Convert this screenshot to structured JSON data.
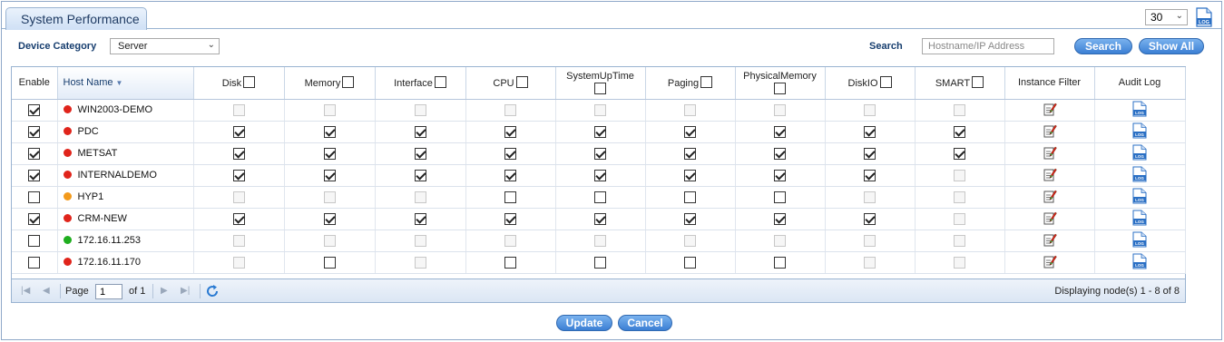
{
  "panel": {
    "tab_title": "System Performance",
    "per_page": "30"
  },
  "filters": {
    "device_category_label": "Device Category",
    "device_category_value": "Server",
    "search_label": "Search",
    "search_placeholder": "Hostname/IP Address",
    "search_button": "Search",
    "show_all_button": "Show All"
  },
  "columns": {
    "enable": "Enable",
    "host_name": "Host Name",
    "disk": "Disk",
    "memory": "Memory",
    "interface": "Interface",
    "cpu": "CPU",
    "systemuptime": "SystemUpTime",
    "paging": "Paging",
    "physicalmemory": "PhysicalMemory",
    "diskio": "DiskIO",
    "smart": "SMART",
    "instance_filter": "Instance Filter",
    "audit_log": "Audit Log"
  },
  "status_colors": {
    "red": "#e0241b",
    "orange": "#f39a1c",
    "green": "#1fae1f"
  },
  "rows": [
    {
      "enable": true,
      "status": "red",
      "host": "WIN2003-DEMO",
      "metrics": [
        "dis",
        "dis",
        "dis",
        "dis",
        "dis",
        "dis",
        "dis",
        "dis",
        "dis"
      ]
    },
    {
      "enable": true,
      "status": "red",
      "host": "PDC",
      "metrics": [
        "on",
        "on",
        "on",
        "on",
        "on",
        "on",
        "on",
        "on",
        "on"
      ]
    },
    {
      "enable": true,
      "status": "red",
      "host": "METSAT",
      "metrics": [
        "on",
        "on",
        "on",
        "on",
        "on",
        "on",
        "on",
        "on",
        "on"
      ]
    },
    {
      "enable": true,
      "status": "red",
      "host": "INTERNALDEMO",
      "metrics": [
        "on",
        "on",
        "on",
        "on",
        "on",
        "on",
        "on",
        "on",
        "dis"
      ]
    },
    {
      "enable": false,
      "status": "orange",
      "host": "HYP1",
      "metrics": [
        "dis",
        "dis",
        "dis",
        "off",
        "off",
        "off",
        "off",
        "dis",
        "dis"
      ]
    },
    {
      "enable": true,
      "status": "red",
      "host": "CRM-NEW",
      "metrics": [
        "on",
        "on",
        "on",
        "on",
        "on",
        "on",
        "on",
        "on",
        "dis"
      ]
    },
    {
      "enable": false,
      "status": "green",
      "host": "172.16.11.253",
      "metrics": [
        "dis",
        "dis",
        "dis",
        "dis",
        "dis",
        "dis",
        "dis",
        "dis",
        "dis"
      ]
    },
    {
      "enable": false,
      "status": "red",
      "host": "172.16.11.170",
      "metrics": [
        "dis",
        "off",
        "dis",
        "off",
        "off",
        "off",
        "off",
        "dis",
        "dis"
      ]
    }
  ],
  "pager": {
    "page_label": "Page",
    "page_value": "1",
    "of_label": "of 1",
    "display_text": "Displaying node(s) 1 - 8 of 8"
  },
  "footer": {
    "update_button": "Update",
    "cancel_button": "Cancel"
  }
}
